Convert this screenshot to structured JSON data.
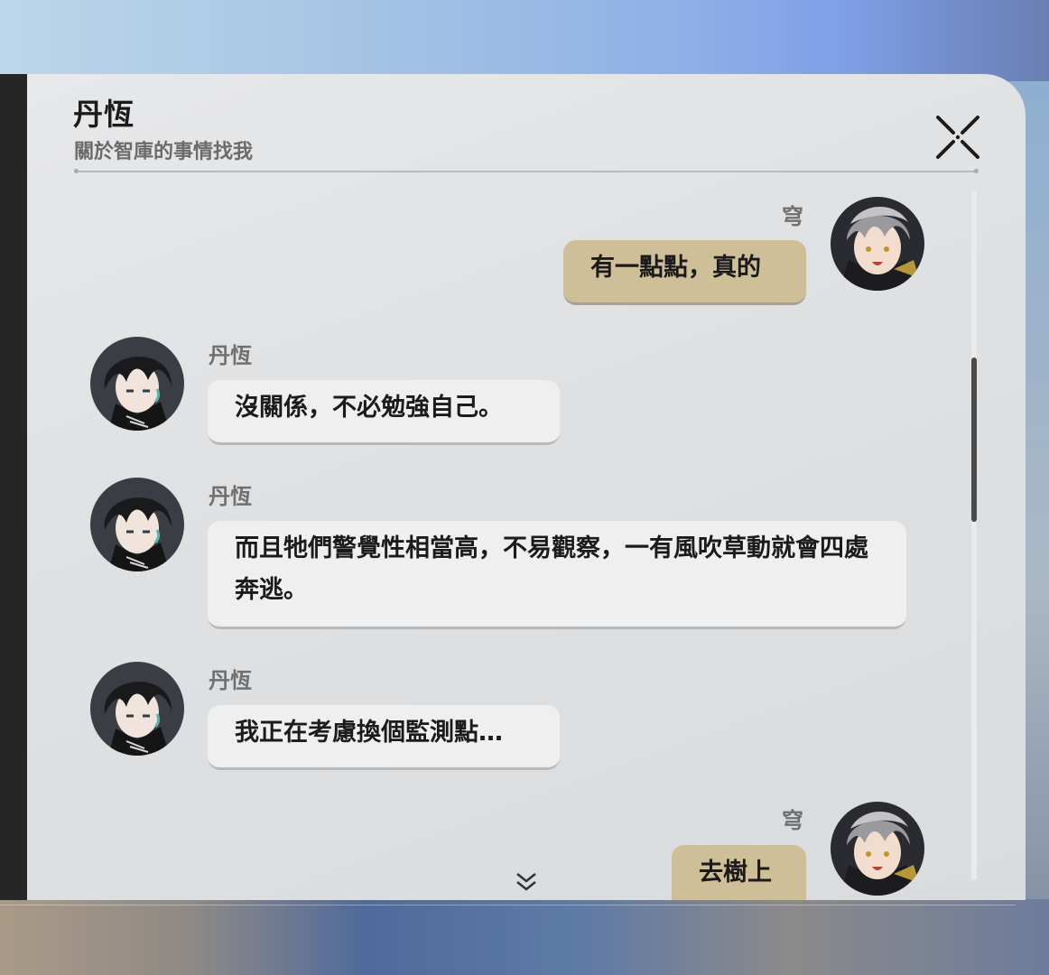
{
  "header": {
    "title": "丹恆",
    "subtitle": "關於智庫的事情找我"
  },
  "icons": {
    "close": "close-icon",
    "scroll_down": "double-chevron-down-icon",
    "avatar_dan_heng": "avatar-dan-heng",
    "avatar_qiong": "avatar-qiong"
  },
  "colors": {
    "outgoing_bubble": "#cfbf98",
    "incoming_bubble": "#efefef",
    "panel": "#e2e3e5",
    "scroll_thumb": "#4a4a4a"
  },
  "messages": [
    {
      "sender": "穹",
      "direction": "out",
      "text": "有一點點，真的"
    },
    {
      "sender": "丹恆",
      "direction": "in",
      "text": "沒關係，不必勉強自己。"
    },
    {
      "sender": "丹恆",
      "direction": "in",
      "text": "而且牠們警覺性相當高，不易觀察，一有風吹草動就會四處奔逃。"
    },
    {
      "sender": "丹恆",
      "direction": "in",
      "text": "我正在考慮換個監測點…"
    },
    {
      "sender": "穹",
      "direction": "out",
      "text": "去樹上"
    }
  ]
}
